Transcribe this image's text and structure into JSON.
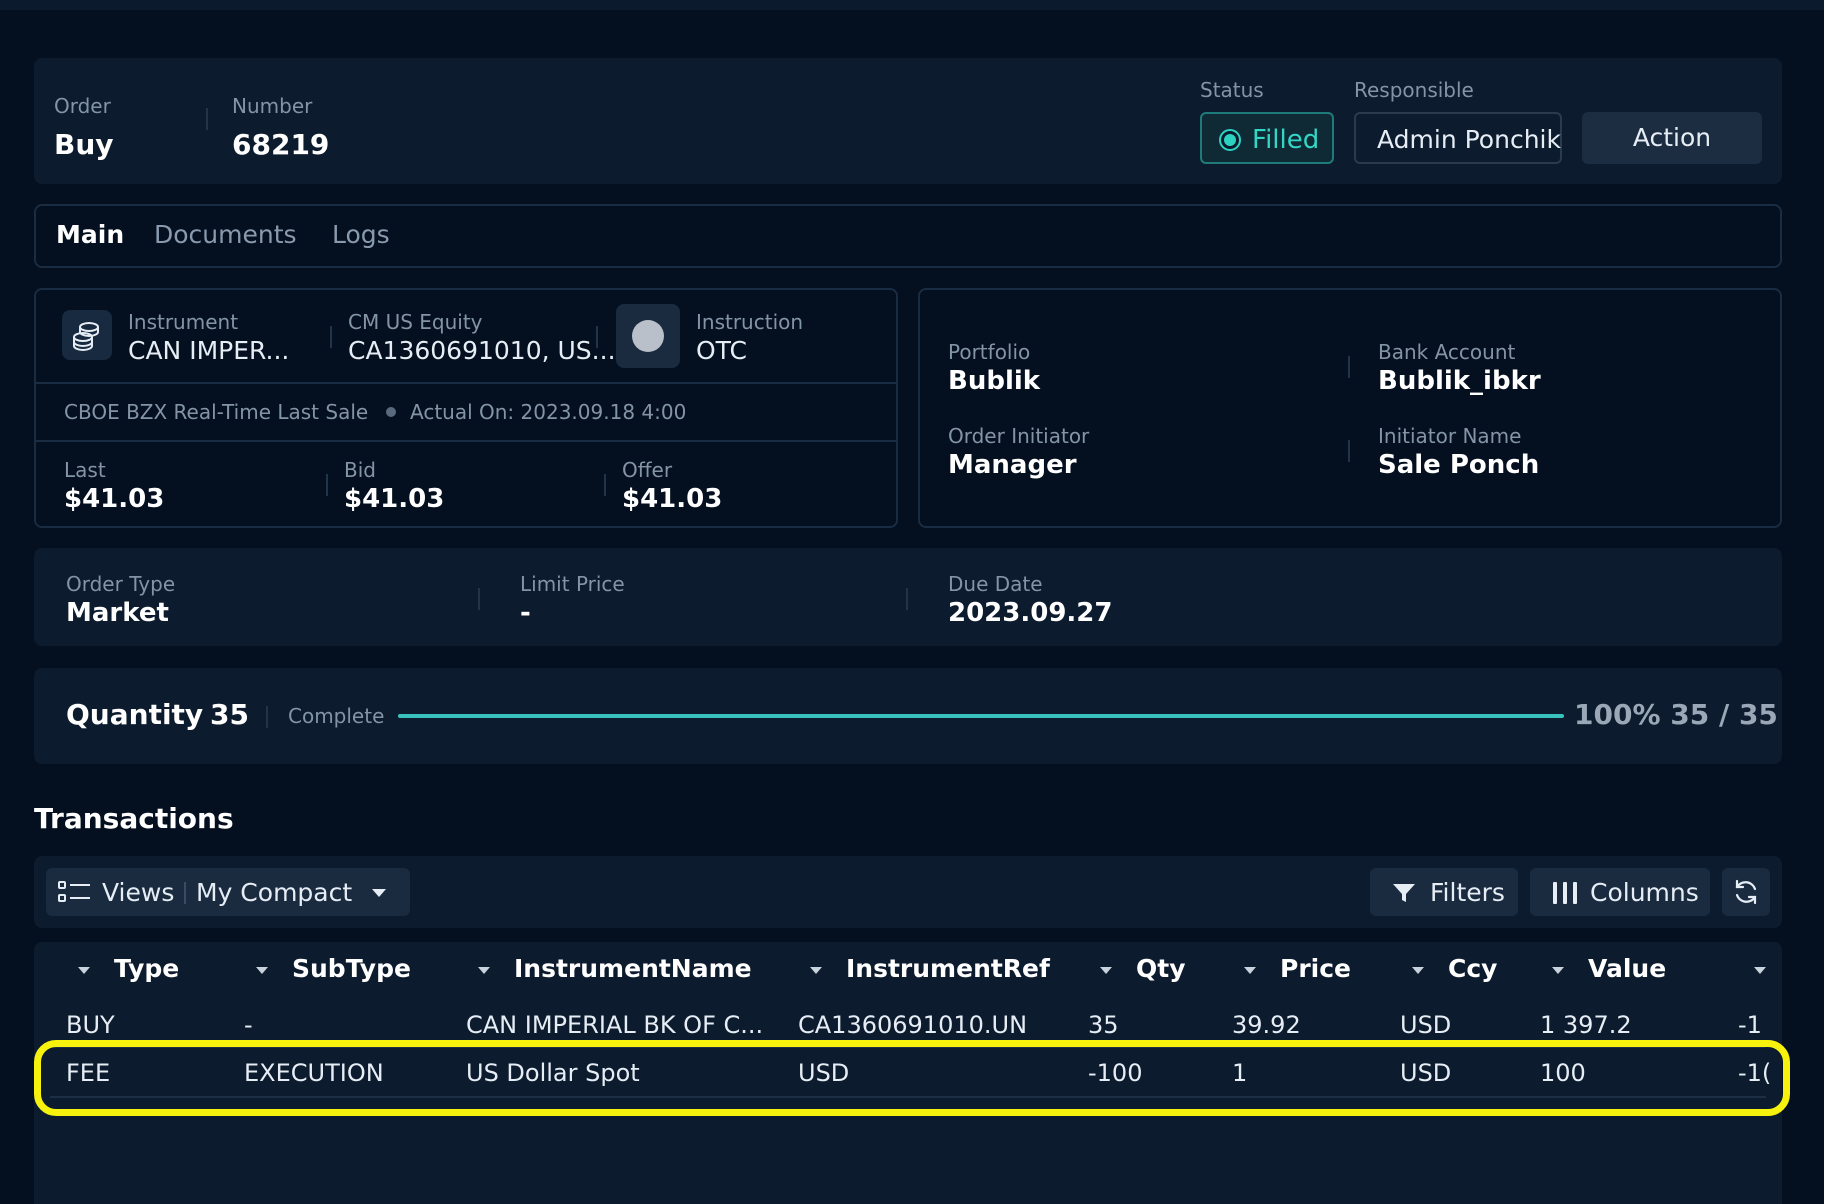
{
  "header": {
    "order_label": "Order",
    "order_value": "Buy",
    "number_label": "Number",
    "number_value": "68219",
    "status_label": "Status",
    "status_value": "Filled",
    "responsible_label": "Responsible",
    "responsible_value": "Admin Ponchik",
    "action_label": "Action"
  },
  "tabs": [
    "Main",
    "Documents",
    "Logs"
  ],
  "instrument": {
    "instrument_label": "Instrument",
    "instrument_value": "CAN IMPER...",
    "equity_label": "CM US Equity",
    "equity_value": "CA1360691010, US...",
    "instruction_label": "Instruction",
    "instruction_value": "OTC",
    "feed_source": "CBOE BZX Real-Time Last Sale",
    "feed_actual": "Actual On: 2023.09.18 4:00",
    "last_label": "Last",
    "last_value": "$41.03",
    "bid_label": "Bid",
    "bid_value": "$41.03",
    "offer_label": "Offer",
    "offer_value": "$41.03"
  },
  "portfolio": {
    "portfolio_label": "Portfolio",
    "portfolio_value": "Bublik",
    "bank_label": "Bank Account",
    "bank_value": "Bublik_ibkr",
    "initiator_label": "Order Initiator",
    "initiator_value": "Manager",
    "initiator_name_label": "Initiator Name",
    "initiator_name_value": "Sale Ponch"
  },
  "order_details": {
    "type_label": "Order Type",
    "type_value": "Market",
    "limit_label": "Limit Price",
    "limit_value": "-",
    "due_label": "Due Date",
    "due_value": "2023.09.27"
  },
  "quantity": {
    "label": "Quantity",
    "value": "35",
    "complete_label": "Complete",
    "progress_fraction": 1.0,
    "progress_text": "100% 35 / 35"
  },
  "transactions": {
    "title": "Transactions",
    "views_label": "Views",
    "view_selected": "My Compact",
    "filters_label": "Filters",
    "columns_label": "Columns",
    "headers": [
      "Type",
      "SubType",
      "InstrumentName",
      "InstrumentRef",
      "Qty",
      "Price",
      "Ccy",
      "Value"
    ],
    "rows": [
      [
        "BUY",
        "-",
        "CAN IMPERIAL BK OF C...",
        "CA1360691010.UN",
        "35",
        "39.92",
        "USD",
        "1 397.2",
        "-1"
      ],
      [
        "FEE",
        "EXECUTION",
        "US Dollar Spot",
        "USD",
        "-100",
        "1",
        "USD",
        "100",
        "-1("
      ]
    ]
  },
  "colors": {
    "accent": "#2bd1c1",
    "highlight": "#f6f20d",
    "background": "#04101f",
    "panel": "#0c1b2d"
  }
}
